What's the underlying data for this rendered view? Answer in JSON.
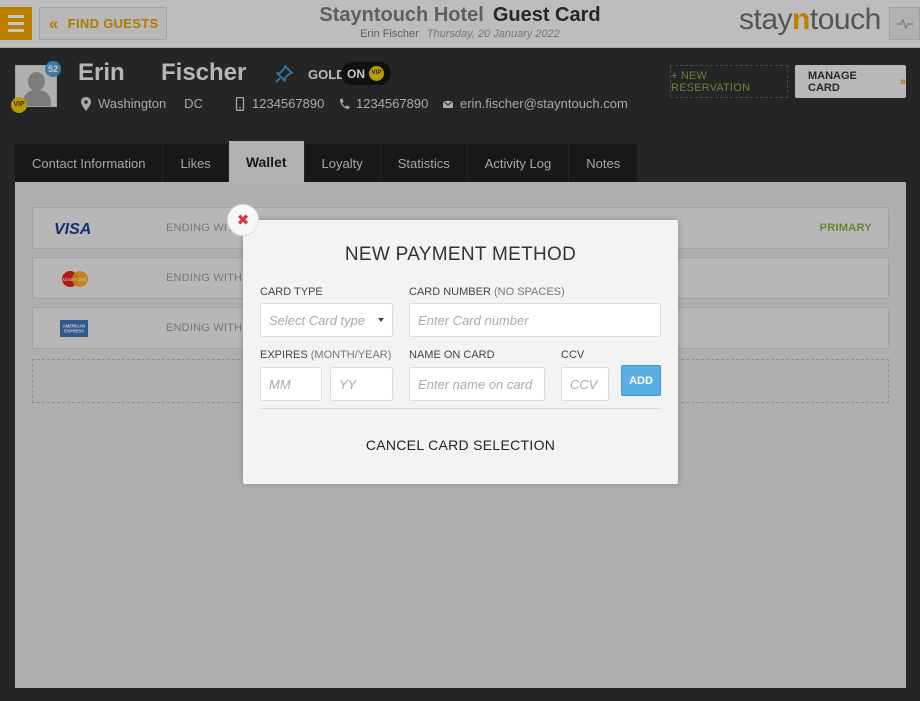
{
  "topbar": {
    "find_guests_label": "FIND GUESTS",
    "hotel_name": "Stayntouch Hotel",
    "page_title": "Guest Card",
    "user_name": "Erin Fischer",
    "date": "Thursday, 20 January 2022",
    "logo_prefix": "stay",
    "logo_n": "n",
    "logo_suffix": "touch"
  },
  "guest": {
    "first_name": "Erin",
    "last_name": "Fischer",
    "count_badge": "52",
    "vip_badge": "VIP",
    "membership": "GOLD",
    "vip_toggle_state": "ON",
    "vip_toggle_badge": "VIP",
    "city": "Washington",
    "state": "DC",
    "mobile": "1234567890",
    "phone": "1234567890",
    "email": "erin.fischer@stayntouch.com"
  },
  "actions": {
    "new_reservation": "+ NEW RESERVATION",
    "manage_card": "MANAGE CARD"
  },
  "tabs": [
    {
      "label": "Contact Information"
    },
    {
      "label": "Likes"
    },
    {
      "label": "Wallet"
    },
    {
      "label": "Loyalty"
    },
    {
      "label": "Statistics"
    },
    {
      "label": "Activity Log"
    },
    {
      "label": "Notes"
    }
  ],
  "active_tab": "Wallet",
  "wallet": {
    "cards": [
      {
        "brand": "VISA",
        "ending_label": "ENDING WITH",
        "primary": "PRIMARY"
      },
      {
        "brand": "MasterCard",
        "ending_label": "ENDING WITH"
      },
      {
        "brand": "AMERICAN EXPRESS",
        "ending_label": "ENDING WITH"
      }
    ]
  },
  "modal": {
    "title": "NEW PAYMENT METHOD",
    "card_type_label": "CARD TYPE",
    "card_type_placeholder": "Select Card type",
    "card_number_label": "CARD NUMBER",
    "card_number_hint": "(NO SPACES)",
    "card_number_placeholder": "Enter Card number",
    "expires_label": "EXPIRES",
    "expires_hint": "(MONTH/YEAR)",
    "month_placeholder": "MM",
    "year_placeholder": "YY",
    "name_label": "NAME ON CARD",
    "name_placeholder": "Enter name on card",
    "ccv_label": "CCV",
    "ccv_placeholder": "CCV",
    "add_label": "ADD",
    "cancel_label": "CANCEL CARD SELECTION",
    "close_glyph": "✖"
  },
  "colors": {
    "accent": "#f0a500",
    "primary_green": "#7fae3f",
    "add_blue": "#5aaee4",
    "close_red": "#d43b3b"
  }
}
